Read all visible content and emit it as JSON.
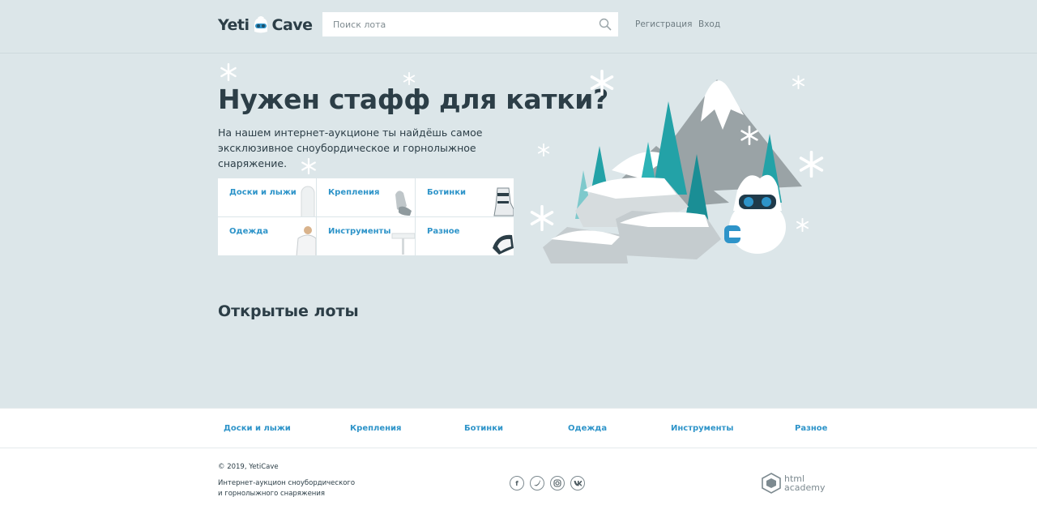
{
  "header": {
    "logo_left": "Yeti",
    "logo_right": "Cave",
    "search_placeholder": "Поиск лота",
    "register": "Регистрация",
    "login": "Вход"
  },
  "promo": {
    "title": "Нужен стафф для катки?",
    "text": "На нашем интернет-аукционе ты найдёшь самое эксклюзивное сноубордическое и горнолыжное снаряжение."
  },
  "categories": [
    {
      "label": "Доски и лыжи",
      "icon": "board-icon"
    },
    {
      "label": "Крепления",
      "icon": "binding-icon"
    },
    {
      "label": "Ботинки",
      "icon": "boot-icon"
    },
    {
      "label": "Одежда",
      "icon": "jacket-icon"
    },
    {
      "label": "Инструменты",
      "icon": "tool-icon"
    },
    {
      "label": "Разное",
      "icon": "goggles-icon"
    }
  ],
  "lots": {
    "title": "Открытые лоты"
  },
  "footer": {
    "nav": [
      "Доски и лыжи",
      "Крепления",
      "Ботинки",
      "Одежда",
      "Инструменты",
      "Разное"
    ],
    "copyright": "© 2019, YetiCave",
    "about": "Интернет-аукцион сноубордического и горнолыжного снаряжения",
    "socials": [
      "facebook-icon",
      "twitter-icon",
      "instagram-icon",
      "vk-icon"
    ],
    "academy_line1": "html",
    "academy_line2": "academy"
  },
  "colors": {
    "background": "#dce6e9",
    "accent": "#2e94c9",
    "text": "#2c3e47"
  }
}
